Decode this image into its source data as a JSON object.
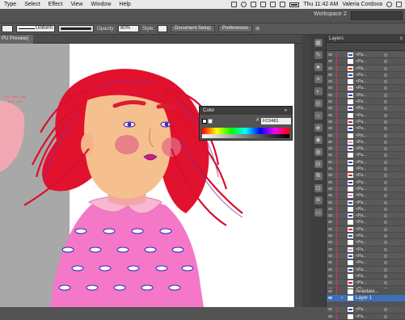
{
  "menubar": {
    "items": [
      "Type",
      "Select",
      "Effect",
      "View",
      "Window",
      "Help"
    ],
    "clock": "Thu 11:42 AM",
    "user": "Valeria Cordova"
  },
  "app": {
    "workspace_label": "Workspace 2"
  },
  "control_bar": {
    "stroke_style": "Uniform",
    "opacity_label": "Opacity:",
    "opacity_value": "80%",
    "style_label": "Style:",
    "document_setup": "Document Setup",
    "preferences": "Preferences"
  },
  "document": {
    "tab_label": "PU Preview)"
  },
  "color_panel": {
    "title": "Color",
    "hex_value": "FC0481"
  },
  "layers_panel": {
    "title": "Layers",
    "sublayer_name": "<Pa...",
    "footer_items": [
      "Anastasi...",
      "Layer 1"
    ]
  },
  "colors": {
    "accent_layer": "#c63a5c",
    "selection": "#3b6fb7"
  }
}
